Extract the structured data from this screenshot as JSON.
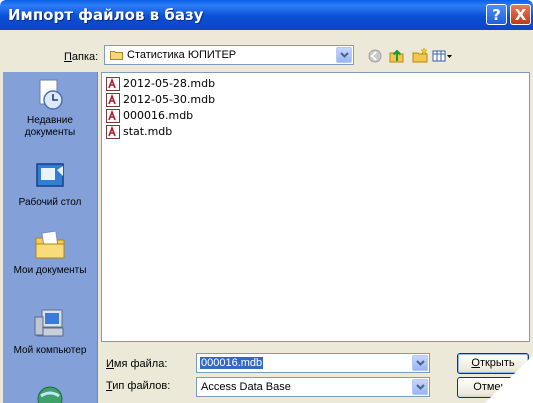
{
  "window": {
    "title": "Импорт файлов в базу",
    "help_label": "?",
    "close_label": "X"
  },
  "lookin": {
    "label_prefix": "",
    "label_accel": "П",
    "label_rest": "апка:",
    "value": "Статистика ЮПИТЕР"
  },
  "toolbar": {
    "back_icon": "back-icon",
    "up_icon": "up-folder-icon",
    "new_folder_icon": "new-folder-icon",
    "views_icon": "views-menu-icon"
  },
  "places": [
    {
      "label": "Недавние документы",
      "icon": "recent-documents-icon"
    },
    {
      "label": "Рабочий стол",
      "icon": "desktop-icon"
    },
    {
      "label": "Мои документы",
      "icon": "my-documents-icon"
    },
    {
      "label": "Мой компьютер",
      "icon": "my-computer-icon"
    },
    {
      "label": "",
      "icon": "network-places-icon"
    }
  ],
  "files": [
    {
      "name": "2012-05-28.mdb"
    },
    {
      "name": "2012-05-30.mdb"
    },
    {
      "name": "000016.mdb"
    },
    {
      "name": "stat.mdb"
    }
  ],
  "filename": {
    "label_accel": "И",
    "label_rest": "мя файла:",
    "value": "000016.mdb"
  },
  "filetype": {
    "label_accel": "Т",
    "label_rest": "ип файлов:",
    "value": "Access Data Base"
  },
  "buttons": {
    "open_accel": "О",
    "open_rest": "ткрыть",
    "cancel": "Отмена"
  },
  "colors": {
    "titlebar": "#0b52dc",
    "places_bar": "#84a0d9",
    "selection": "#316ac5",
    "dialog_bg": "#ece9d8"
  }
}
